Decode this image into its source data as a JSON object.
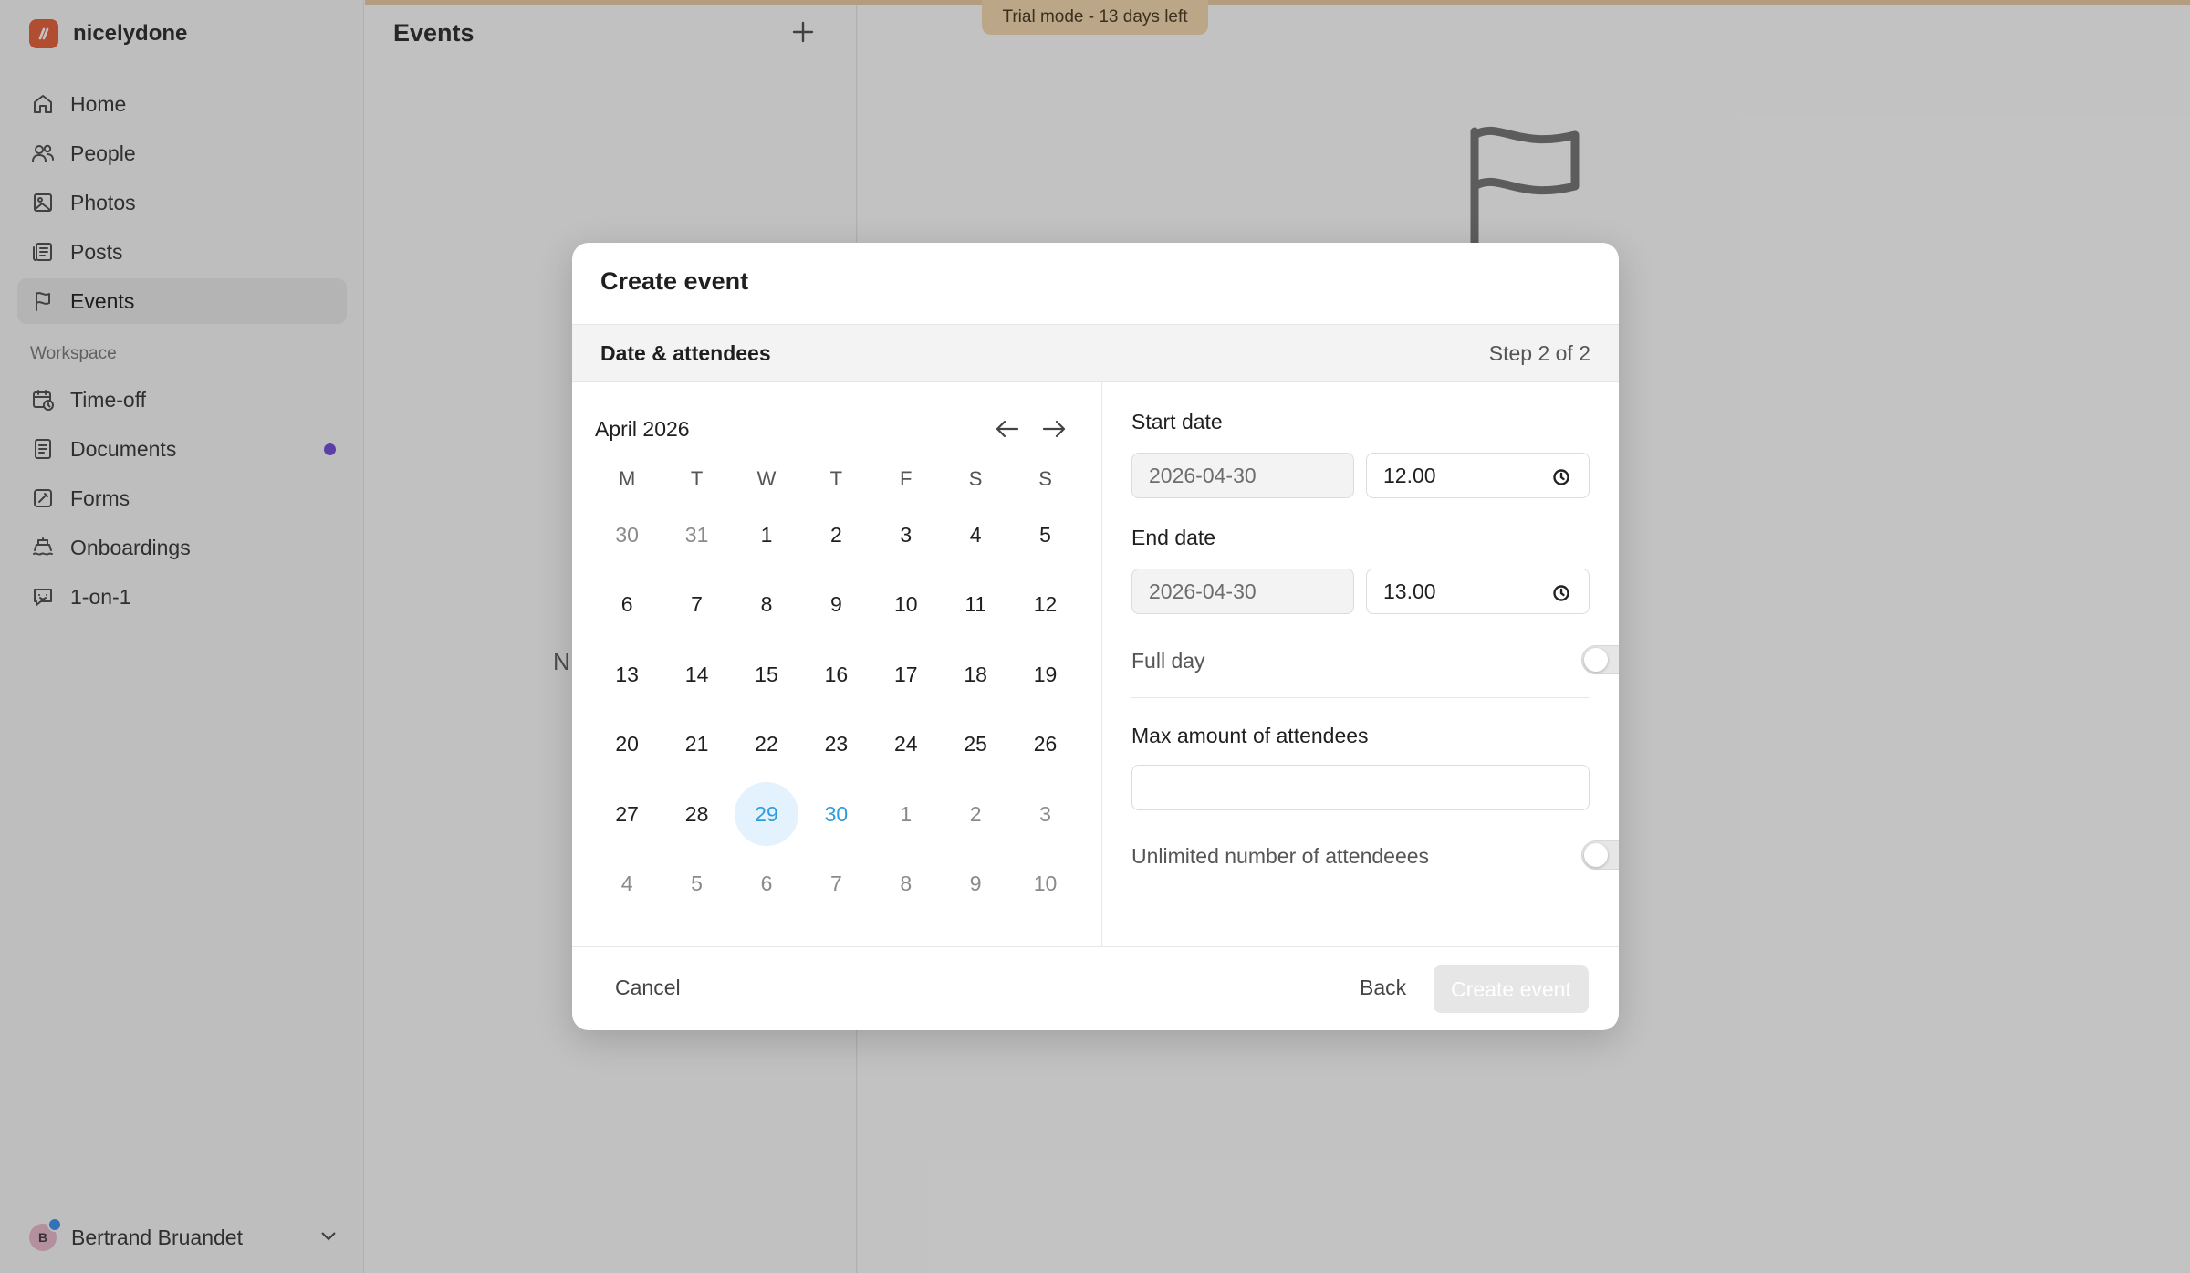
{
  "app": {
    "name": "nicelydone",
    "brand_color": "#e4572e"
  },
  "trial": {
    "label": "Trial mode - 13 days left"
  },
  "sidebar": {
    "items": [
      {
        "label": "Home",
        "icon": "home-icon",
        "active": false
      },
      {
        "label": "People",
        "icon": "people-icon",
        "active": false
      },
      {
        "label": "Photos",
        "icon": "photo-icon",
        "active": false
      },
      {
        "label": "Posts",
        "icon": "posts-icon",
        "active": false
      },
      {
        "label": "Events",
        "icon": "flag-icon",
        "active": true
      }
    ],
    "workspace_label": "Workspace",
    "workspace_items": [
      {
        "label": "Time-off",
        "icon": "calendar-clock-icon"
      },
      {
        "label": "Documents",
        "icon": "document-icon",
        "badge_dot": true
      },
      {
        "label": "Forms",
        "icon": "form-icon"
      },
      {
        "label": "Onboardings",
        "icon": "onboarding-icon"
      },
      {
        "label": "1-on-1",
        "icon": "chat-icon"
      }
    ],
    "user": {
      "initial": "B",
      "name": "Bertrand Bruandet"
    }
  },
  "events_panel": {
    "title": "Events",
    "partial_text": "N"
  },
  "modal": {
    "title": "Create event",
    "step_title": "Date & attendees",
    "step_count": "Step 2 of 2",
    "calendar": {
      "month_label": "April 2026",
      "weekdays": [
        "M",
        "T",
        "W",
        "T",
        "F",
        "S",
        "S"
      ],
      "weeks": [
        [
          {
            "d": "30",
            "m": true
          },
          {
            "d": "31",
            "m": true
          },
          {
            "d": "1"
          },
          {
            "d": "2"
          },
          {
            "d": "3"
          },
          {
            "d": "4"
          },
          {
            "d": "5"
          }
        ],
        [
          {
            "d": "6"
          },
          {
            "d": "7"
          },
          {
            "d": "8"
          },
          {
            "d": "9"
          },
          {
            "d": "10"
          },
          {
            "d": "11"
          },
          {
            "d": "12"
          }
        ],
        [
          {
            "d": "13"
          },
          {
            "d": "14"
          },
          {
            "d": "15"
          },
          {
            "d": "16"
          },
          {
            "d": "17"
          },
          {
            "d": "18"
          },
          {
            "d": "19"
          }
        ],
        [
          {
            "d": "20"
          },
          {
            "d": "21"
          },
          {
            "d": "22"
          },
          {
            "d": "23"
          },
          {
            "d": "24"
          },
          {
            "d": "25"
          },
          {
            "d": "26"
          }
        ],
        [
          {
            "d": "27"
          },
          {
            "d": "28"
          },
          {
            "d": "29",
            "s": true
          },
          {
            "d": "30",
            "t": true
          },
          {
            "d": "1",
            "m": true
          },
          {
            "d": "2",
            "m": true
          },
          {
            "d": "3",
            "m": true
          }
        ],
        [
          {
            "d": "4",
            "m": true
          },
          {
            "d": "5",
            "m": true
          },
          {
            "d": "6",
            "m": true
          },
          {
            "d": "7",
            "m": true
          },
          {
            "d": "8",
            "m": true
          },
          {
            "d": "9",
            "m": true
          },
          {
            "d": "10",
            "m": true
          }
        ]
      ],
      "selected_color": "#2d9bdc"
    },
    "form": {
      "start_label": "Start date",
      "start_date": "2026-04-30",
      "start_time": "12.00",
      "end_label": "End date",
      "end_date": "2026-04-30",
      "end_time": "13.00",
      "full_day_label": "Full day",
      "full_day": false,
      "max_label": "Max amount of attendees",
      "max_value": "",
      "unlimited_label": "Unlimited number of attendeees",
      "unlimited": false
    },
    "footer": {
      "cancel": "Cancel",
      "back": "Back",
      "create": "Create event"
    }
  }
}
